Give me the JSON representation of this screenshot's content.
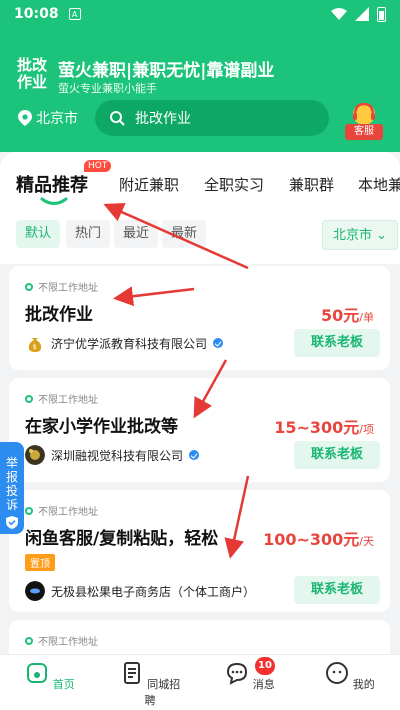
{
  "status_bar": {
    "time": "10:08",
    "notification_icon": "A"
  },
  "header": {
    "logo_text": "批改作业",
    "slogan": "萤火兼职|兼职无忧|靠谱副业",
    "subslogan": "萤火专业兼职小能手",
    "city": "北京市",
    "search_text": "批改作业",
    "service_label": "客服"
  },
  "tabs": [
    "精品推荐",
    "附近兼职",
    "全职实习",
    "兼职群",
    "本地兼"
  ],
  "hot_badge": "HOT",
  "filters": [
    "默认",
    "热门",
    "最近",
    "最新"
  ],
  "city_filter": "北京市 ⌄",
  "jobs": [
    {
      "location": "不限工作地址",
      "title": "批改作业",
      "salary": "50元",
      "unit": "/单",
      "company": "济宁优学派教育科技有限公司",
      "contact": "联系老板"
    },
    {
      "location": "不限工作地址",
      "title": "在家小学作业批改等",
      "salary": "15~300元",
      "unit": "/项",
      "company": "深圳融视觉科技有限公司",
      "contact": "联系老板"
    },
    {
      "location": "不限工作地址",
      "title": "闲鱼客服/复制粘贴，轻松",
      "salary": "100~300元",
      "unit": "/天",
      "tag": "置顶",
      "company": "无极县松果电子商务店（个体工商户）",
      "contact": "联系老板"
    },
    {
      "location": "不限工作地址"
    }
  ],
  "report_tab": "举报投诉",
  "bottom_nav": [
    {
      "label": "首页"
    },
    {
      "label": "同城招聘"
    },
    {
      "label": "消息",
      "badge": "10"
    },
    {
      "label": "我的"
    }
  ],
  "colors": {
    "primary": "#1bc47a",
    "salary": "#e8463d",
    "report": "#2d8cf0",
    "arrow": "#e53935"
  }
}
